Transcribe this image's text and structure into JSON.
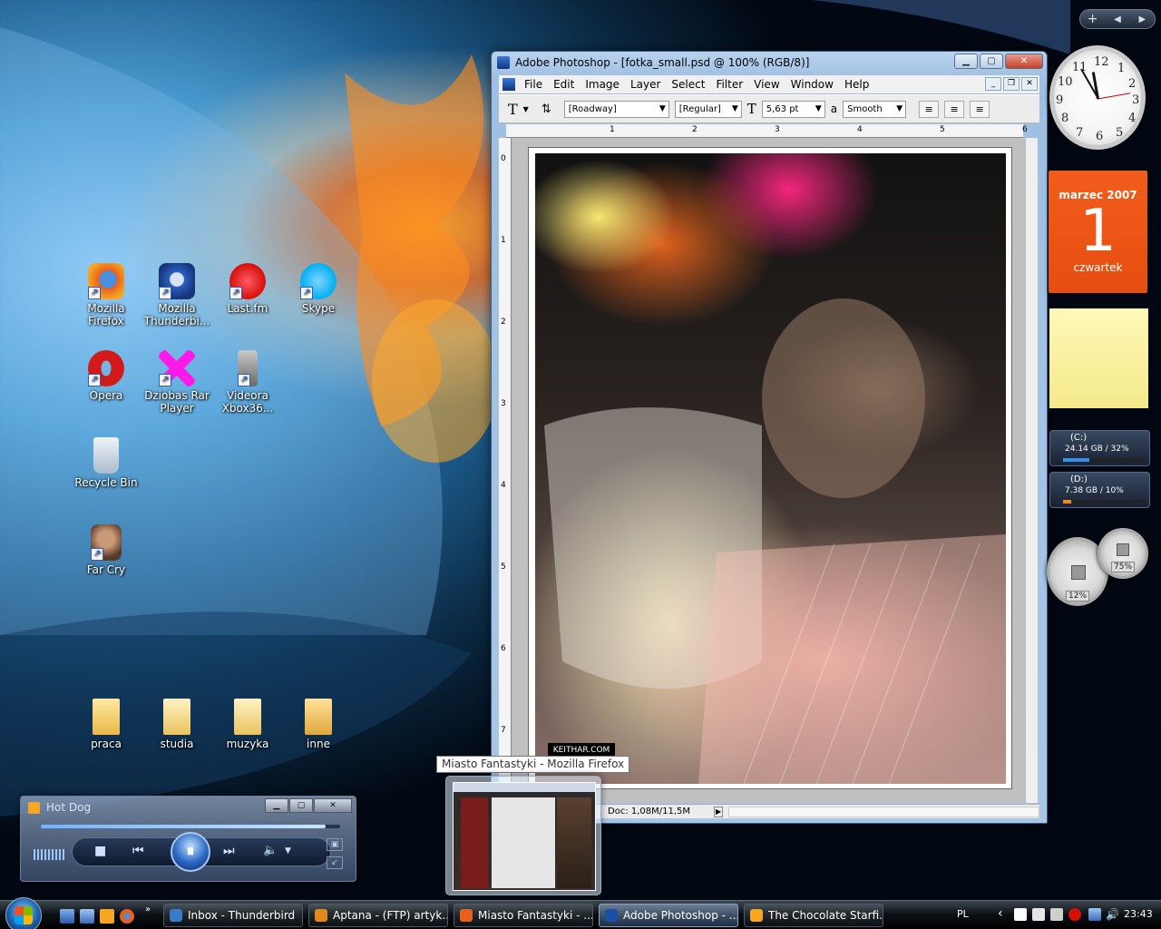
{
  "desktop": {
    "icons": [
      {
        "label": "Mozilla Firefox"
      },
      {
        "label": "Mozilla Thunderbi..."
      },
      {
        "label": "Last.fm"
      },
      {
        "label": "Skype"
      },
      {
        "label": "Opera"
      },
      {
        "label": "Dziobas Rar Player"
      },
      {
        "label": "Videora Xbox36..."
      },
      {
        "label": "Recycle Bin"
      },
      {
        "label": "Far Cry"
      },
      {
        "label": "praca"
      },
      {
        "label": "studia"
      },
      {
        "label": "muzyka"
      },
      {
        "label": "inne"
      }
    ]
  },
  "photoshop": {
    "title": "Adobe Photoshop - [fotka_small.psd @ 100% (RGB/8)]",
    "menu": [
      "File",
      "Edit",
      "Image",
      "Layer",
      "Select",
      "Filter",
      "View",
      "Window",
      "Help"
    ],
    "options": {
      "tool_glyph": "T",
      "font_family": "[Roadway]",
      "font_style": "[Regular]",
      "font_size": "5,63 pt",
      "antialias_label": "a",
      "antialias": "Smooth"
    },
    "ruler_top": [
      "1",
      "2",
      "3",
      "4",
      "5",
      "6"
    ],
    "ruler_left": [
      "0",
      "1",
      "2",
      "3",
      "4",
      "5",
      "6",
      "7"
    ],
    "watermark": "KEITHAR.COM",
    "status": "Doc: 1,08M/11,5M"
  },
  "tooltip": "Miasto Fantastyki - Mozilla Firefox",
  "media_player": {
    "track": "Hot Dog",
    "seek_fraction": 0.95,
    "buttons": {
      "stop": "■",
      "prev": "⏮",
      "pause": "⏸",
      "next": "⏭",
      "volume": "🔈"
    }
  },
  "sidebar": {
    "clock_numbers": [
      "12",
      "1",
      "2",
      "3",
      "4",
      "5",
      "6",
      "7",
      "8",
      "9",
      "10",
      "11"
    ],
    "calendar": {
      "month_year": "marzec 2007",
      "day": "1",
      "weekday": "czwartek"
    },
    "drives": [
      {
        "label": "(C:)",
        "info": "24.14 GB / 32%",
        "used": 0.32,
        "color": "#3a8fe8"
      },
      {
        "label": "(D:)",
        "info": "7.38 GB / 10%",
        "used": 0.1,
        "color": "#f08a1c"
      }
    ],
    "cpu_gauge": "12%",
    "ram_gauge": "75%"
  },
  "taskbar": {
    "tasks": [
      {
        "label": "Inbox - Thunderbird",
        "color": "#3a78c8"
      },
      {
        "label": "Aptana - (FTP) artyk...",
        "color": "#e08a1c"
      },
      {
        "label": "Miasto Fantastyki - ...",
        "color": "#e8601c"
      },
      {
        "label": "Adobe Photoshop - ...",
        "color": "#1c4fa8"
      },
      {
        "label": "The Chocolate Starfi...",
        "color": "#f5a623"
      }
    ],
    "lang": "PL",
    "time": "23:43"
  }
}
